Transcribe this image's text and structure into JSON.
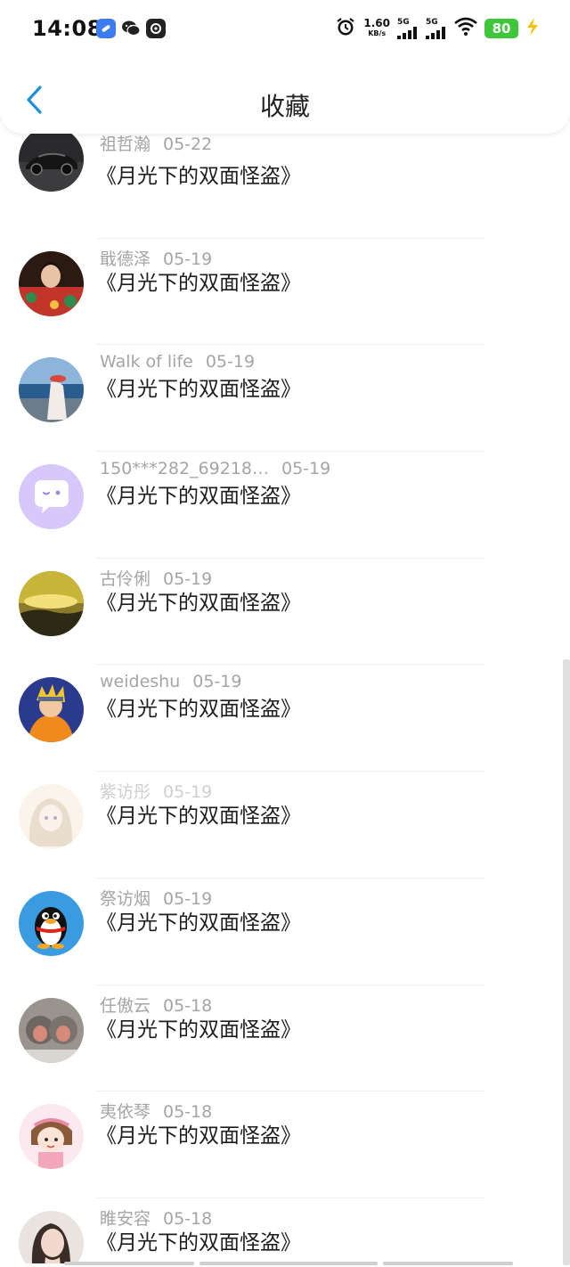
{
  "status_bar": {
    "time": "14:08",
    "net_speed_value": "1.60",
    "net_speed_unit": "KB/s",
    "sim1": "5G",
    "sim2": "5G",
    "battery": "80",
    "app_icons": [
      "clip-icon",
      "wechat-icon",
      "gallery-icon"
    ]
  },
  "header": {
    "title": "收藏",
    "back_icon": "chevron-left-icon",
    "accent_color": "#1a8fe0"
  },
  "items": [
    {
      "name": "祖哲瀚",
      "date": "05-22",
      "title": "《月光下的双面怪盗》",
      "avatar": "car-avatar"
    },
    {
      "name": "戢德泽",
      "date": "05-19",
      "title": "《月光下的双面怪盗》",
      "avatar": "woman-floral-avatar"
    },
    {
      "name": "Walk of life",
      "date": "05-19",
      "title": "《月光下的双面怪盗》",
      "avatar": "seaside-avatar"
    },
    {
      "name": "150***282_69218…",
      "date": "05-19",
      "title": "《月光下的双面怪盗》",
      "avatar": "chat-bubble-avatar"
    },
    {
      "name": "古伶俐",
      "date": "05-19",
      "title": "《月光下的双面怪盗》",
      "avatar": "sunset-avatar"
    },
    {
      "name": "weideshu",
      "date": "05-19",
      "title": "《月光下的双面怪盗》",
      "avatar": "anime-ninja-avatar"
    },
    {
      "name": "紫访彤",
      "date": "05-19",
      "title": "《月光下的双面怪盗》",
      "avatar": "anime-girl-avatar"
    },
    {
      "name": "祭访烟",
      "date": "05-19",
      "title": "《月光下的双面怪盗》",
      "avatar": "penguin-avatar"
    },
    {
      "name": "任傲云",
      "date": "05-18",
      "title": "《月光下的双面怪盗》",
      "avatar": "monkeys-avatar"
    },
    {
      "name": "夷依琴",
      "date": "05-18",
      "title": "《月光下的双面怪盗》",
      "avatar": "cartoon-girl-avatar"
    },
    {
      "name": "睢安容",
      "date": "05-18",
      "title": "《月光下的双面怪盗》",
      "avatar": "portrait-avatar"
    }
  ]
}
